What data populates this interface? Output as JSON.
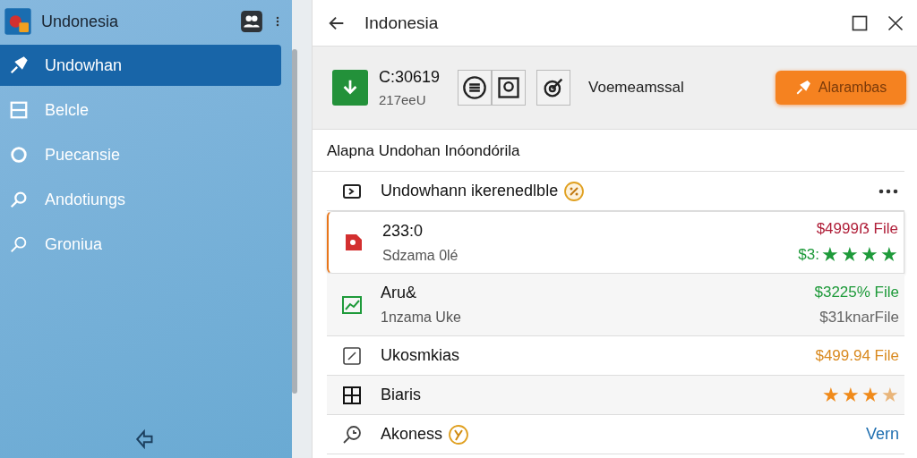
{
  "sidebar": {
    "title": "Undonesia",
    "items": [
      {
        "label": "Undowhan",
        "selected": true
      },
      {
        "label": "Belcle",
        "selected": false
      },
      {
        "label": "Puecansie",
        "selected": false
      },
      {
        "label": "Andotiungs",
        "selected": false
      },
      {
        "label": "Groniua",
        "selected": false
      }
    ]
  },
  "window": {
    "title": "Indonesia"
  },
  "toolbar": {
    "code": "C:30619",
    "code_sub": "217eeU",
    "label": "Voemeamssal",
    "action_button": "Alarambas"
  },
  "heading": "Alapna Undohan Inóondórila",
  "rows": [
    {
      "title": "Undowhann ikerenedlble",
      "selected": false
    },
    {
      "title": "233:0",
      "subtitle": "Sdzama 0lé",
      "selected": true,
      "right_top": {
        "text": "$4999ẞ File",
        "color": "#b0203a"
      },
      "right_bottom": {
        "text": "$3:",
        "color": "#1e9a3a"
      },
      "stars": 4
    },
    {
      "title": "Aru&",
      "subtitle": "1nzama Uke",
      "selected": false,
      "right_top": {
        "text": "$3225% File",
        "color": "#1e9a3a"
      },
      "right_bottom": {
        "text": "$31knarFile",
        "color": "#666666"
      }
    },
    {
      "title": "Ukosmkias",
      "selected": false,
      "right_top": {
        "text": "$499.94 File",
        "color": "#d98a20"
      }
    },
    {
      "title": "Biaris",
      "selected": false,
      "stars": 3
    },
    {
      "title": "Akoness",
      "selected": false,
      "link": "Vern"
    }
  ]
}
